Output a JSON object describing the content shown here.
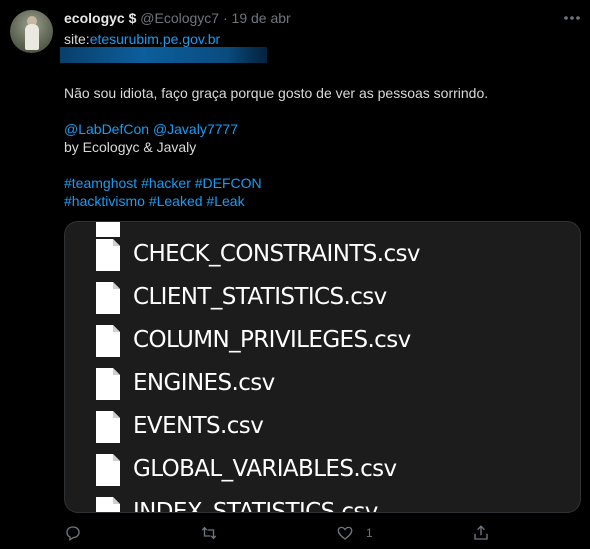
{
  "tweet": {
    "author_name": "ecologyc $",
    "author_handle": "@Ecologyc7",
    "separator": "·",
    "date": "19 de abr",
    "site_prefix": "site:",
    "site_link": "etesurubim.pe.gov.br",
    "line_message": "Não sou idiota, faço graça porque gosto de ver as pessoas sorrindo.",
    "mention_1": "@LabDefCon",
    "mention_2": "@Javaly7777",
    "byline": "by Ecologyc & Javaly",
    "hashtags_line_1": [
      "#teamghost",
      "#hacker",
      "#DEFCON"
    ],
    "hashtags_line_2": [
      "#hacktivismo",
      "#Leaked",
      "#Leak"
    ]
  },
  "media": {
    "files": [
      "CHECK_CONSTRAINTS.csv",
      "CLIENT_STATISTICS.csv",
      "COLUMN_PRIVILEGES.csv",
      "ENGINES.csv",
      "EVENTS.csv",
      "GLOBAL_VARIABLES.csv",
      "INDEX_STATISTICS.csv"
    ]
  },
  "actions": {
    "reply_icon": "reply-icon",
    "retweet_icon": "retweet-icon",
    "like_icon": "heart-icon",
    "like_count": "1",
    "share_icon": "share-icon"
  },
  "colors": {
    "background": "#000000",
    "text": "#d9d9d9",
    "link": "#1d9bf0",
    "muted": "#6e767d",
    "media_bg": "#1c1c1c"
  }
}
